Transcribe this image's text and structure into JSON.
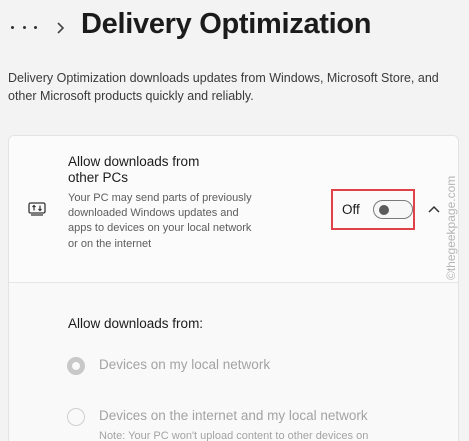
{
  "header": {
    "more_icon": "ellipsis-icon",
    "separator_icon": "chevron-right-icon",
    "title": "Delivery Optimization"
  },
  "description": "Delivery Optimization downloads updates from Windows, Microsoft Store, and other Microsoft products quickly and reliably.",
  "setting": {
    "icon": "pc-transfer-icon",
    "title": "Allow downloads from other PCs",
    "description": "Your PC may send parts of previously downloaded Windows updates and apps to devices on your local network or on the internet",
    "toggle": {
      "label": "Off",
      "state": false
    },
    "expand_icon": "chevron-up-icon",
    "highlight_color": "#e0424a"
  },
  "options": {
    "label": "Allow downloads from:",
    "items": [
      {
        "label": "Devices on my local network",
        "selected": true,
        "enabled": false
      },
      {
        "label": "Devices on the internet and my local network",
        "note": "Note: Your PC won't upload content to other devices on",
        "selected": false,
        "enabled": false
      }
    ]
  },
  "watermark": "©thegeekpage.com"
}
